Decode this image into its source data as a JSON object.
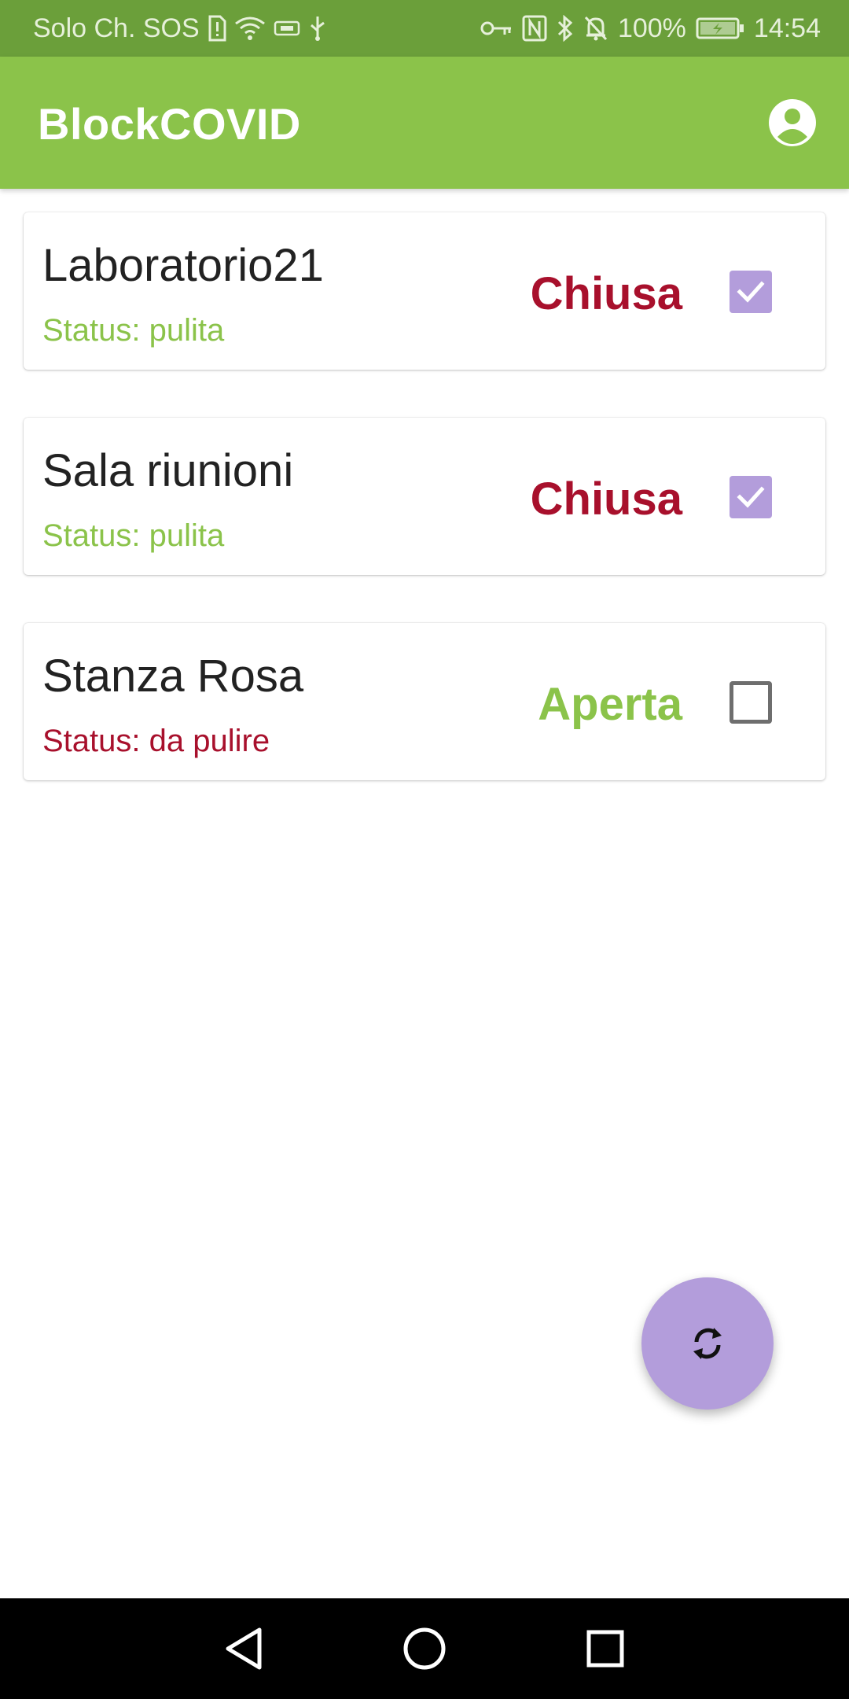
{
  "status_bar": {
    "carrier": "Solo Ch. SOS",
    "battery": "100%",
    "time": "14:54",
    "icons_left": [
      "sim-alert-icon",
      "wifi-icon",
      "vpn-badge-icon",
      "usb-icon"
    ],
    "icons_right": [
      "key-icon",
      "nfc-icon",
      "bluetooth-icon",
      "mute-bell-icon",
      "battery-icon"
    ]
  },
  "app_bar": {
    "title": "BlockCOVID",
    "account_icon": "account-circle-icon"
  },
  "rooms": [
    {
      "name": "Laboratorio21",
      "status": "Status: pulita",
      "state": "Chiusa",
      "checked": true
    },
    {
      "name": "Sala riunioni",
      "status": "Status: pulita",
      "state": "Chiusa",
      "checked": true
    },
    {
      "name": "Stanza Rosa",
      "status": "Status: da pulire",
      "state": "Aperta",
      "checked": false
    }
  ],
  "fab": {
    "icon": "refresh-icon"
  },
  "nav_bar": {
    "icons": [
      "back-icon",
      "home-icon",
      "recents-icon"
    ]
  },
  "colors": {
    "status_bar": "#6b9f3a",
    "app_bar": "#8bc34a",
    "clean_green": "#8bc34a",
    "dirty_red": "#a8102c",
    "closed_red": "#a8102c",
    "open_green": "#8bc34a",
    "accent_purple": "#b39ddb"
  }
}
